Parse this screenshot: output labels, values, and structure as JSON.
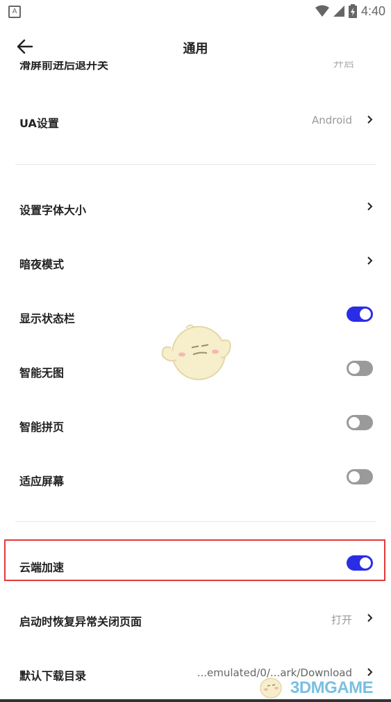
{
  "status_bar": {
    "time": "4:40",
    "left_icon_letter": "A"
  },
  "app_bar": {
    "title": "通用"
  },
  "partial_row": {
    "label": "滑屏前进后退开关",
    "value": "开启"
  },
  "rows": [
    {
      "label": "UA设置",
      "value": "Android"
    },
    {
      "label": "设置字体大小"
    },
    {
      "label": "暗夜模式"
    },
    {
      "label": "显示状态栏",
      "toggle": "on"
    },
    {
      "label": "智能无图",
      "toggle": "off"
    },
    {
      "label": "智能拼页",
      "toggle": "off"
    },
    {
      "label": "适应屏幕",
      "toggle": "off"
    },
    {
      "label": "云端加速",
      "toggle": "on"
    },
    {
      "label": "启动时恢复异常关闭页面",
      "value": "打开"
    },
    {
      "label": "默认下载目录",
      "value": "...emulated/0/...ark/Download"
    }
  ],
  "watermark": {
    "text": "3DMGAME"
  },
  "colors": {
    "accent": "#2a2de6",
    "highlight": "#e0393a",
    "toggle_off": "#9a9a9a"
  }
}
